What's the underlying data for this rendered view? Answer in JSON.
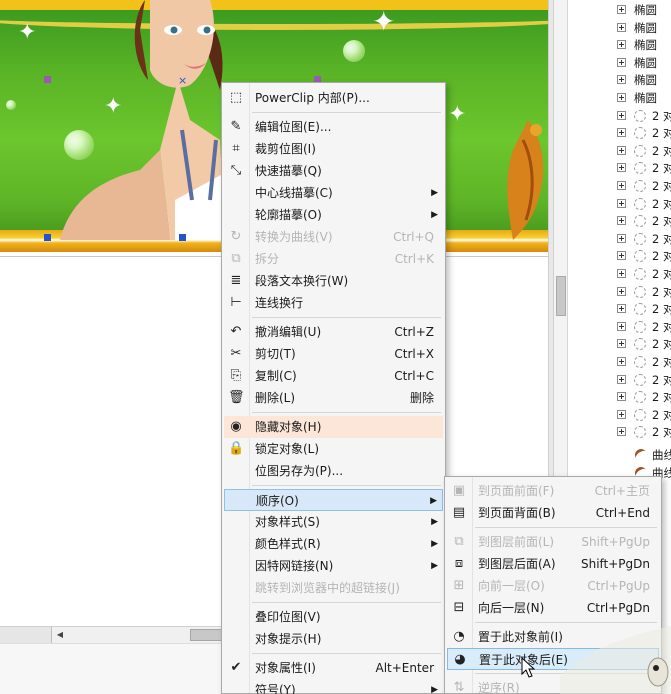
{
  "object_manager": {
    "rows": [
      {
        "type": "shape",
        "label": "椭圆"
      },
      {
        "type": "shape",
        "label": "椭圆"
      },
      {
        "type": "shape",
        "label": "椭圆"
      },
      {
        "type": "shape",
        "label": "椭圆"
      },
      {
        "type": "shape",
        "label": "椭圆"
      },
      {
        "type": "shape",
        "label": "椭圆"
      },
      {
        "type": "group",
        "label": "2 对"
      },
      {
        "type": "group",
        "label": "2 对"
      },
      {
        "type": "group",
        "label": "2 对"
      },
      {
        "type": "group",
        "label": "2 对"
      },
      {
        "type": "group",
        "label": "2 对"
      },
      {
        "type": "group",
        "label": "2 对"
      },
      {
        "type": "group",
        "label": "2 对"
      },
      {
        "type": "group",
        "label": "2 对"
      },
      {
        "type": "group",
        "label": "2 对"
      },
      {
        "type": "group",
        "label": "2 对"
      },
      {
        "type": "group",
        "label": "2 对"
      },
      {
        "type": "group",
        "label": "2 对"
      },
      {
        "type": "group",
        "label": "2 对"
      },
      {
        "type": "group",
        "label": "2 对"
      },
      {
        "type": "group",
        "label": "2 对"
      },
      {
        "type": "group",
        "label": "2 对"
      },
      {
        "type": "group",
        "label": "2 对"
      },
      {
        "type": "group",
        "label": "2 对"
      },
      {
        "type": "group",
        "label": "2 对"
      },
      {
        "type": "curve",
        "label": "曲线"
      },
      {
        "type": "curve",
        "label": "曲线"
      }
    ]
  },
  "context_menu": {
    "items": [
      {
        "label": "PowerClip 内部(P)...",
        "icon": "powerclip-icon",
        "disabled": false
      },
      {
        "sep": true
      },
      {
        "label": "编辑位图(E)...",
        "icon": "edit-bitmap-icon",
        "disabled": false
      },
      {
        "label": "裁剪位图(I)",
        "icon": "crop-bitmap-icon",
        "disabled": false
      },
      {
        "label": "快速描摹(Q)",
        "icon": "quick-trace-icon",
        "disabled": false
      },
      {
        "label": "中心线描摹(C)",
        "icon": "",
        "disabled": false,
        "submenu": true
      },
      {
        "label": "轮廓描摹(O)",
        "icon": "",
        "disabled": false,
        "submenu": true
      },
      {
        "label": "转换为曲线(V)",
        "icon": "convert-curves-icon",
        "shortcut": "Ctrl+Q",
        "disabled": true
      },
      {
        "label": "拆分",
        "icon": "break-apart-icon",
        "shortcut": "Ctrl+K",
        "disabled": true
      },
      {
        "label": "段落文本换行(W)",
        "icon": "wrap-text-icon",
        "disabled": false
      },
      {
        "label": "连线换行",
        "icon": "connector-wrap-icon",
        "disabled": false
      },
      {
        "sep": true
      },
      {
        "label": "撤消编辑(U)",
        "icon": "undo-icon",
        "shortcut": "Ctrl+Z",
        "disabled": false
      },
      {
        "label": "剪切(T)",
        "icon": "cut-icon",
        "shortcut": "Ctrl+X",
        "disabled": false
      },
      {
        "label": "复制(C)",
        "icon": "copy-icon",
        "shortcut": "Ctrl+C",
        "disabled": false
      },
      {
        "label": "删除(L)",
        "icon": "delete-icon",
        "shortcut": "删除",
        "disabled": false
      },
      {
        "sep": true
      },
      {
        "label": "隐藏对象(H)",
        "icon": "hide-object-icon",
        "disabled": false,
        "highlight": "peach"
      },
      {
        "label": "锁定对象(L)",
        "icon": "lock-icon",
        "disabled": false
      },
      {
        "label": "位图另存为(P)...",
        "icon": "",
        "disabled": false
      },
      {
        "sep": true
      },
      {
        "label": "顺序(O)",
        "icon": "",
        "disabled": false,
        "submenu": true,
        "highlight": "blue"
      },
      {
        "label": "对象样式(S)",
        "icon": "",
        "disabled": false,
        "submenu": true
      },
      {
        "label": "颜色样式(R)",
        "icon": "",
        "disabled": false,
        "submenu": true
      },
      {
        "label": "因特网链接(N)",
        "icon": "",
        "disabled": false,
        "submenu": true
      },
      {
        "label": "跳转到浏览器中的超链接(J)",
        "icon": "",
        "disabled": true
      },
      {
        "sep": true
      },
      {
        "label": "叠印位图(V)",
        "icon": "",
        "disabled": false
      },
      {
        "label": "对象提示(H)",
        "icon": "",
        "disabled": false
      },
      {
        "sep": true
      },
      {
        "label": "对象属性(I)",
        "icon": "check-icon",
        "shortcut": "Alt+Enter",
        "disabled": false
      },
      {
        "label": "符号(Y)",
        "icon": "",
        "disabled": false,
        "submenu": true
      }
    ]
  },
  "order_submenu": {
    "items": [
      {
        "label": "到页面前面(F)",
        "icon": "to-page-front-icon",
        "shortcut": "Ctrl+主页",
        "disabled": true
      },
      {
        "label": "到页面背面(B)",
        "icon": "to-page-back-icon",
        "shortcut": "Ctrl+End",
        "disabled": false
      },
      {
        "sep": true
      },
      {
        "label": "到图层前面(L)",
        "icon": "to-layer-front-icon",
        "shortcut": "Shift+PgUp",
        "disabled": true
      },
      {
        "label": "到图层后面(A)",
        "icon": "to-layer-back-icon",
        "shortcut": "Shift+PgDn",
        "disabled": false
      },
      {
        "label": "向前一层(O)",
        "icon": "forward-one-icon",
        "shortcut": "Ctrl+PgUp",
        "disabled": true
      },
      {
        "label": "向后一层(N)",
        "icon": "back-one-icon",
        "shortcut": "Ctrl+PgDn",
        "disabled": false
      },
      {
        "sep": true
      },
      {
        "label": "置于此对象前(I)",
        "icon": "in-front-of-icon",
        "disabled": false
      },
      {
        "label": "置于此对象后(E)",
        "icon": "behind-icon",
        "disabled": false,
        "highlight": "blue"
      },
      {
        "sep": true
      },
      {
        "label": "逆序(R)",
        "icon": "reverse-order-icon",
        "disabled": true
      }
    ]
  },
  "colors": {
    "menu_bg": "#f5f5f5",
    "highlight_peach": "#fbe6d8",
    "highlight_blue": "#d7e9f8",
    "disabled_text": "#b5b5b5",
    "artwork_green": "#59b326",
    "artwork_yellow": "#f2c21a"
  }
}
